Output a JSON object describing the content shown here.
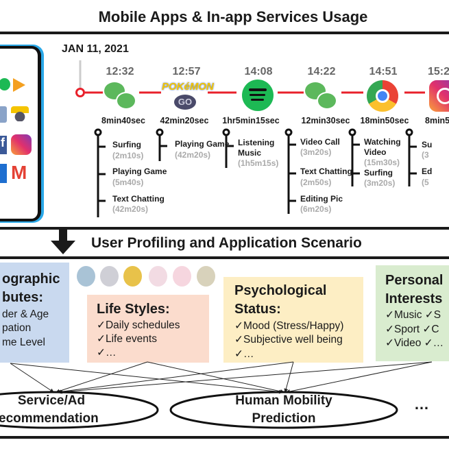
{
  "title": "Mobile Apps & In-app Services Usage",
  "date": "JAN 11, 2021",
  "timeline": [
    {
      "time": "12:32",
      "app": "wechat-icon",
      "duration": "8min40sec",
      "activities": [
        {
          "label": "Surfing",
          "time": "(2m10s)"
        },
        {
          "label": "Playing Game",
          "time": "(5m40s)"
        },
        {
          "label": "Text Chatting",
          "time": "(42m20s)"
        }
      ]
    },
    {
      "time": "12:57",
      "app": "pokemon-go-icon",
      "duration": "42min20sec",
      "activities": [
        {
          "label": "Playing Game",
          "time": "(42m20s)"
        }
      ]
    },
    {
      "time": "14:08",
      "app": "spotify-icon",
      "duration": "1hr5min15sec",
      "activities": [
        {
          "label": "Listening",
          "label2": "Music",
          "time": "(1h5m15s)"
        }
      ]
    },
    {
      "time": "14:22",
      "app": "wechat-icon",
      "duration": "12min30sec",
      "activities": [
        {
          "label": "Video Call",
          "time": "(3m20s)"
        },
        {
          "label": "Text Chatting",
          "time": "(2m50s)"
        },
        {
          "label": "Editing Pic",
          "time": "(6m20s)"
        }
      ]
    },
    {
      "time": "14:51",
      "app": "chrome-icon",
      "duration": "18min50sec",
      "activities": [
        {
          "label": "Watching",
          "label2": "Video",
          "time": "(15m30s)"
        },
        {
          "label": "Surfing",
          "time": "(3m20s)"
        }
      ]
    },
    {
      "time": "15:2",
      "app": "instagram-icon",
      "duration": "8min5",
      "activities": [
        {
          "label": "Su",
          "time": "(3"
        },
        {
          "label": "Ed",
          "time": "(5"
        }
      ]
    }
  ],
  "section2_title": "User Profiling and  Application Scenario",
  "boxes": {
    "demographic": {
      "title1": "ographic",
      "title2": "butes:",
      "items": [
        "der & Age",
        "pation",
        "me Level"
      ],
      "color": "#c9d9ef"
    },
    "lifestyles": {
      "title": "Life Styles:",
      "items": [
        "✓Daily schedules",
        "✓Life events",
        "✓…"
      ],
      "color": "#fbdccd"
    },
    "psychological": {
      "title1": "Psychological",
      "title2": "Status:",
      "items": [
        "✓Mood (Stress/Happy)",
        "✓Subjective well being",
        "✓…"
      ],
      "color": "#fdeec4"
    },
    "interests": {
      "title1": "Personal",
      "title2": "Interests",
      "items": [
        "✓Music ✓S",
        "✓Sport  ✓C",
        "✓Video  ✓…"
      ],
      "color": "#d9eccf"
    }
  },
  "applications": {
    "service": {
      "line1": "Service/Ad",
      "line2": "ecommendation"
    },
    "mobility": {
      "line1": "Human Mobility",
      "line2": "Prediction"
    },
    "more": "…"
  },
  "colors": {
    "timeline_red": "#e8202a",
    "phone_blue": "#2aa8e8"
  }
}
